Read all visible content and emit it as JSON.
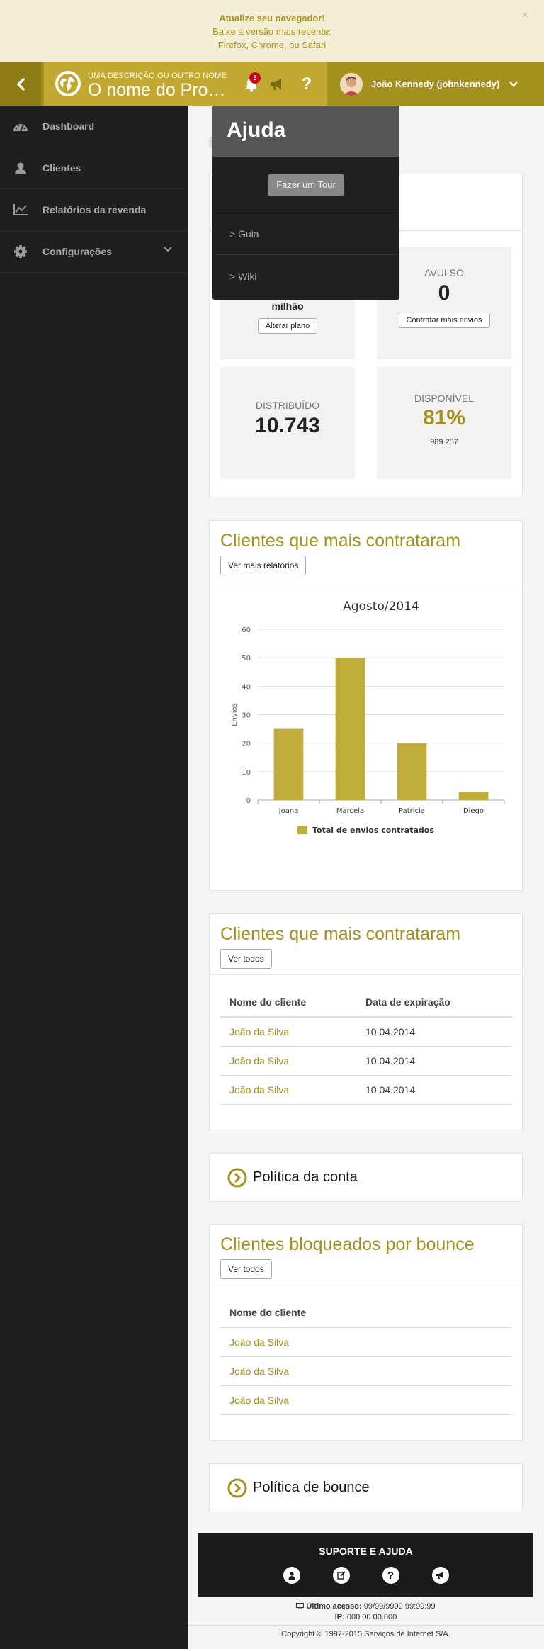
{
  "banner": {
    "title": "Atualize seu navegador!",
    "line2": "Baixe a versão mais recente:",
    "line3": "Firefox, Chrome, ou Safari",
    "close": "×"
  },
  "header": {
    "subtitle": "UMA DESCRIÇÃO OU OUTRO NOME",
    "title": "O nome do Produto",
    "notifications_count": "5",
    "user_name": "João Kennedy (johnkennedy)"
  },
  "sidebar": {
    "items": [
      {
        "label": "Dashboard",
        "icon": "dashboard-icon"
      },
      {
        "label": "Clientes",
        "icon": "user-icon"
      },
      {
        "label": "Relatórios da revenda",
        "icon": "chart-line-icon"
      },
      {
        "label": "Configurações",
        "icon": "gear-icon"
      }
    ]
  },
  "help_menu": {
    "title": "Ajuda",
    "tour_button": "Fazer um Tour",
    "links": [
      "> Guia",
      "> Wiki"
    ]
  },
  "plan": {
    "hidden_stat_unit": "milhão",
    "change_plan_button": "Alterar plano",
    "avulso_label": "AVULSO",
    "avulso_value": "0",
    "buy_more_button": "Contratar mais envios",
    "distributed_label": "DISTRIBUÍDO",
    "distributed_value": "10.743",
    "available_label": "DISPONÍVEL",
    "available_percent": "81%",
    "available_value": "989.257"
  },
  "top_clients_chart_card": {
    "title": "Clientes que mais contrataram",
    "button": "Ver mais relatórios"
  },
  "chart_data": {
    "type": "bar",
    "title": "Agosto/2014",
    "categories": [
      "Joana",
      "Marcela",
      "Patricia",
      "Diego"
    ],
    "series": [
      {
        "name": "Total de envios contratados",
        "values": [
          25,
          50,
          20,
          3
        ]
      }
    ],
    "ylabel": "Envios",
    "xlabel": "",
    "ylim": [
      0,
      60
    ],
    "yticks": [
      "0",
      "10",
      "20",
      "30",
      "40",
      "50",
      "60"
    ],
    "color": "#c1ad3c",
    "legend": "bottom",
    "grid": true
  },
  "top_clients_table": {
    "title": "Clientes que mais contrataram",
    "button": "Ver todos",
    "headers": [
      "Nome do cliente",
      "Data de expiração"
    ],
    "rows": [
      [
        "João da Silva",
        "10.04.2014"
      ],
      [
        "João da Silva",
        "10.04.2014"
      ],
      [
        "João da Silva",
        "10.04.2014"
      ]
    ]
  },
  "account_policy": {
    "label": "Política da conta"
  },
  "bounce_table": {
    "title": "Clientes bloqueados por bounce",
    "button": "Ver todos",
    "header": "Nome do cliente",
    "rows": [
      "João da Silva",
      "João da Silva",
      "João da Silva"
    ]
  },
  "bounce_policy": {
    "label": "Política de bounce"
  },
  "footer": {
    "title": "SUPORTE E AJUDA",
    "last_access_label": "Último acesso:",
    "last_access_value": "99/99/9999 99:99:99",
    "ip_label": "IP:",
    "ip_value": "000.00.00.000",
    "copyright": "Copyright © 1997-2015 Serviços de Internet S/A."
  }
}
